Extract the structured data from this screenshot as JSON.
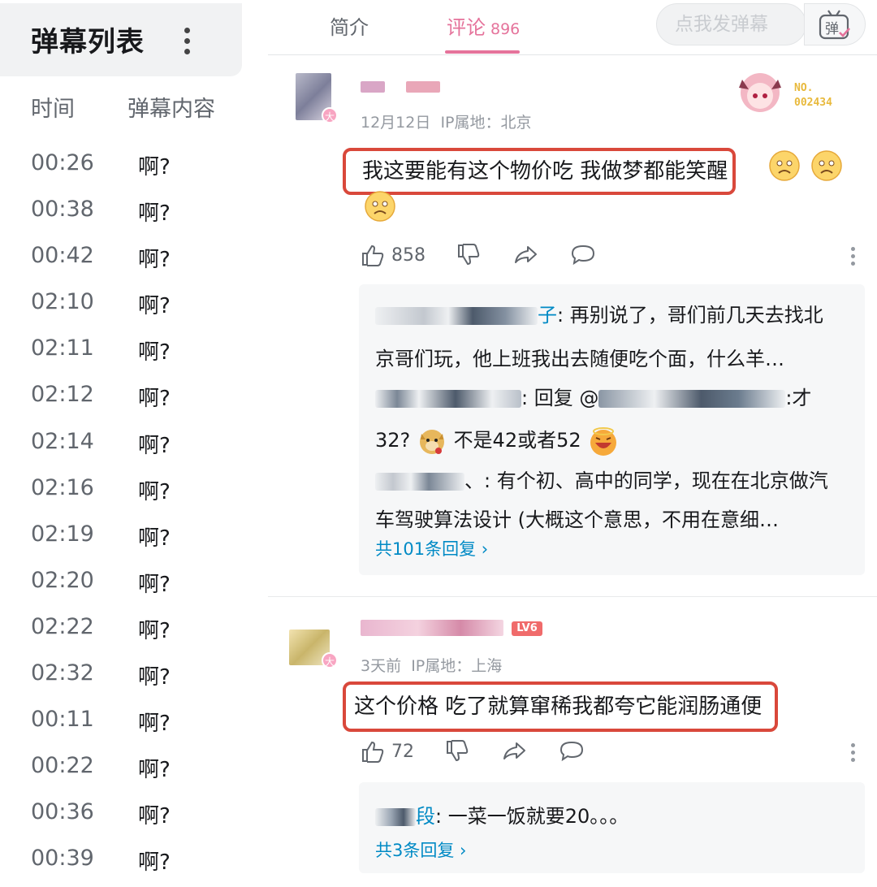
{
  "left_panel": {
    "title": "弹幕列表",
    "col_time": "时间",
    "col_content": "弹幕内容",
    "rows": [
      {
        "time": "00:26",
        "text": "啊?"
      },
      {
        "time": "00:38",
        "text": "啊?"
      },
      {
        "time": "00:42",
        "text": "啊?"
      },
      {
        "time": "02:10",
        "text": "啊?"
      },
      {
        "time": "02:11",
        "text": "啊?"
      },
      {
        "time": "02:12",
        "text": "啊?"
      },
      {
        "time": "02:14",
        "text": "啊?"
      },
      {
        "time": "02:16",
        "text": "啊?"
      },
      {
        "time": "02:19",
        "text": "啊?"
      },
      {
        "time": "02:20",
        "text": "啊?"
      },
      {
        "time": "02:22",
        "text": "啊?"
      },
      {
        "time": "02:32",
        "text": "啊?"
      },
      {
        "time": "00:11",
        "text": "啊?"
      },
      {
        "time": "00:22",
        "text": "啊?"
      },
      {
        "time": "00:36",
        "text": "啊?"
      },
      {
        "time": "00:39",
        "text": "啊?"
      }
    ]
  },
  "tabs": {
    "intro": "简介",
    "comments": "评论",
    "comments_count": "896"
  },
  "danmaku_input": {
    "placeholder": "点我发弹幕",
    "button_glyph": "弹"
  },
  "comments": [
    {
      "date": "12月12日",
      "ip_label": "IP属地：北京",
      "content": "我这要能有这个物价吃 我做梦都能笑醒",
      "avatar_badge": "大",
      "fan_badge_text": "NO.\n002434",
      "likes": "858",
      "replies": [
        {
          "name_suffix": "子",
          "text": ": 再别说了，哥们前几天去找北",
          "text2": "京哥们玩，他上班我出去随便吃个面，什么羊…"
        },
        {
          "text": ": 回复 @",
          "text_end": ":才",
          "text2a": "32?",
          "text2b": "不是42或者52"
        },
        {
          "text": "、: 有个初、高中的同学，现在在北京做汽",
          "text2": "车驾驶算法设计 (大概这个意思，不用在意细…"
        }
      ],
      "more_replies": "共101条回复 ›"
    },
    {
      "date": "3天前",
      "ip_label": "IP属地：上海",
      "content": "这个价格 吃了就算窜稀我都夸它能润肠通便",
      "avatar_badge": "大",
      "level": "LV6",
      "likes": "72",
      "replies": [
        {
          "name_suffix": "段",
          "text": ": 一菜一饭就要20。。。"
        }
      ],
      "more_replies": "共3条回复 ›"
    }
  ],
  "colors": {
    "accent_pink": "#e5739b",
    "link_blue": "#008ac5",
    "highlight_red": "#d9483b"
  }
}
